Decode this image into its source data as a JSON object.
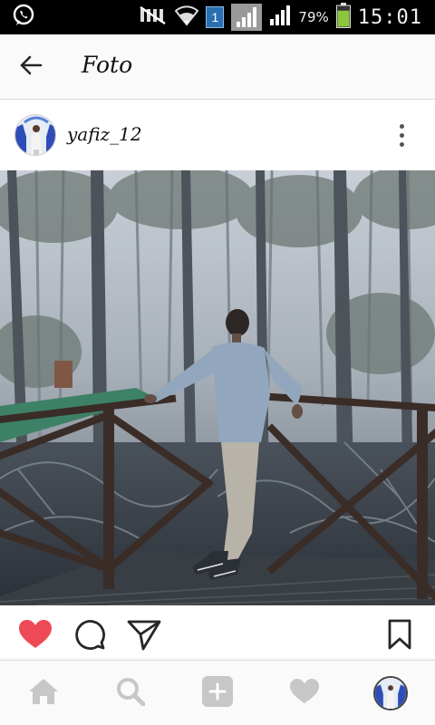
{
  "status_bar": {
    "sim_slot": "1",
    "battery_percent": "79%",
    "battery_level": 0.79,
    "time": "15:01",
    "icons": [
      "whatsapp-icon",
      "mute-icon",
      "wifi-icon",
      "signal-icon",
      "battery-icon"
    ]
  },
  "header": {
    "title": "Foto",
    "back_icon": "arrow-left-icon"
  },
  "post": {
    "username": "yafiz_12",
    "more_icon": "more-vertical-icon",
    "liked": true,
    "colors": {
      "like": "#ed4956",
      "icon": "#262626"
    }
  },
  "actions": [
    "heart-filled-icon",
    "comment-icon",
    "send-icon",
    "bookmark-icon"
  ],
  "bottom_nav": {
    "items": [
      "home-icon",
      "search-icon",
      "add-post-icon",
      "activity-heart-icon",
      "profile-avatar"
    ],
    "inactive_color": "#c7c7c7"
  }
}
